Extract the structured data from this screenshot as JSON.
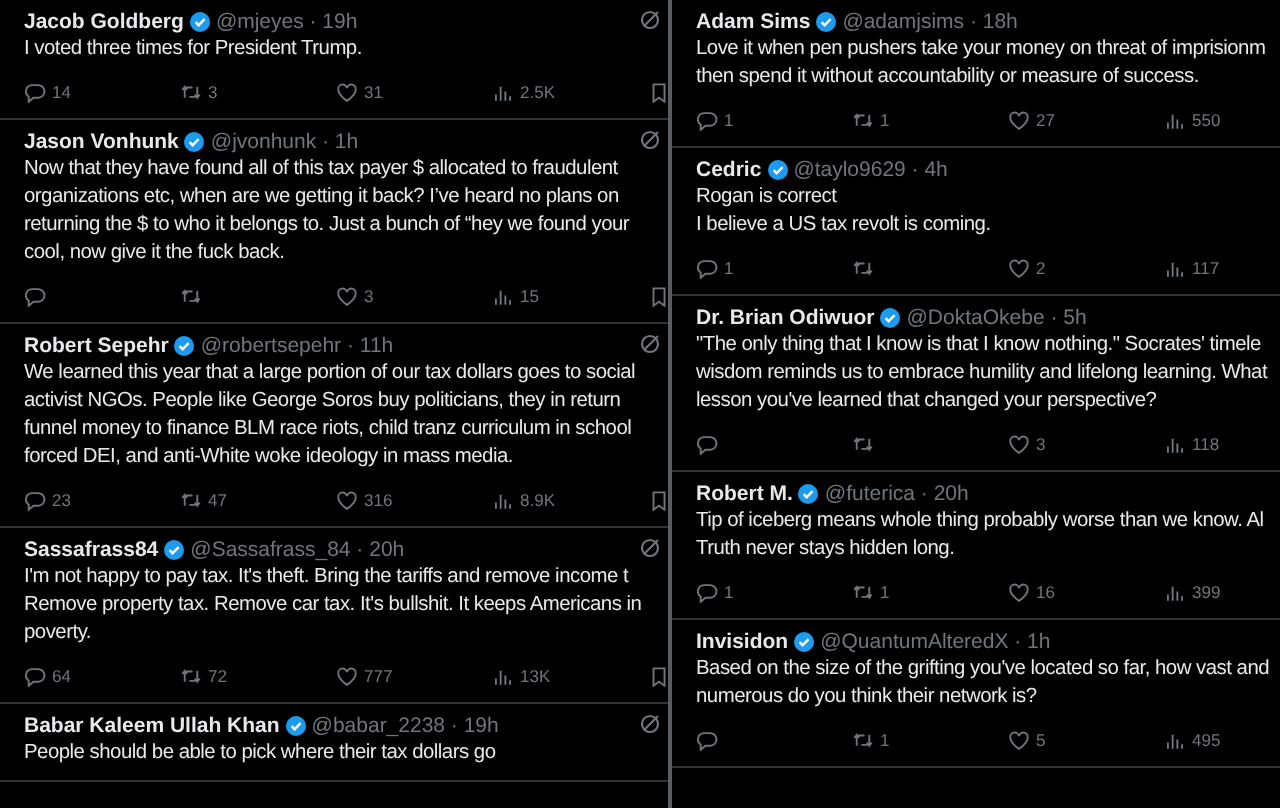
{
  "columns": [
    {
      "tweets": [
        {
          "name": "Jacob Goldberg",
          "meta": "@mjeyes · 19h",
          "menu_icon": true,
          "lines": [
            "I voted three times for President Trump."
          ],
          "actions": [
            {
              "kind": "reply",
              "count": "14"
            },
            {
              "kind": "repost",
              "count": "3"
            },
            {
              "kind": "like",
              "count": "31"
            },
            {
              "kind": "views",
              "count": "2.5K"
            },
            {
              "kind": "bookmark"
            }
          ]
        },
        {
          "name": "Jason Vonhunk",
          "meta": "@jvonhunk · 1h",
          "menu_icon": true,
          "lines": [
            "Now that they have found all of this tax payer $ allocated to fraudulent",
            "organizations etc, when are we getting it back? I’ve heard no plans on",
            "returning the $ to who it belongs to. Just a bunch of “hey we found your",
            "cool, now give it the fuck back."
          ],
          "actions": [
            {
              "kind": "reply"
            },
            {
              "kind": "repost"
            },
            {
              "kind": "like",
              "count": "3"
            },
            {
              "kind": "views",
              "count": "15"
            },
            {
              "kind": "bookmark"
            }
          ]
        },
        {
          "name": "Robert Sepehr",
          "meta": "@robertsepehr · 11h",
          "menu_icon": true,
          "lines": [
            "We learned this year that a large portion of our tax dollars goes to social",
            "activist NGOs. People like George Soros buy politicians, they in return",
            "funnel money to finance BLM race riots, child tranz curriculum in school",
            "forced DEI, and anti-White woke ideology in mass media."
          ],
          "actions": [
            {
              "kind": "reply",
              "count": "23"
            },
            {
              "kind": "repost",
              "count": "47"
            },
            {
              "kind": "like",
              "count": "316"
            },
            {
              "kind": "views",
              "count": "8.9K"
            },
            {
              "kind": "bookmark"
            }
          ]
        },
        {
          "name": "Sassafrass84",
          "meta": "@Sassafrass_84 · 20h",
          "menu_icon": true,
          "lines": [
            "I'm not happy to pay tax. It's theft. Bring the tariffs and remove income t",
            "Remove property tax. Remove car tax. It's bullshit. It keeps Americans in",
            "poverty."
          ],
          "actions": [
            {
              "kind": "reply",
              "count": "64"
            },
            {
              "kind": "repost",
              "count": "72"
            },
            {
              "kind": "like",
              "count": "777"
            },
            {
              "kind": "views",
              "count": "13K"
            },
            {
              "kind": "bookmark"
            }
          ]
        },
        {
          "name": "Babar Kaleem Ullah Khan",
          "meta": "@babar_2238 · 19h",
          "menu_icon": true,
          "lines": [
            "People should be able to pick where their tax dollars go"
          ]
        }
      ]
    },
    {
      "tweets": [
        {
          "name": "Adam Sims",
          "meta": "@adamjsims · 18h",
          "menu_icon": false,
          "lines": [
            "Love it when pen pushers take your money on threat of imprisionm",
            "then spend it without accountability or measure of success."
          ],
          "actions": [
            {
              "kind": "reply",
              "count": "1"
            },
            {
              "kind": "repost",
              "count": "1"
            },
            {
              "kind": "like",
              "count": "27"
            },
            {
              "kind": "views",
              "count": "550"
            }
          ]
        },
        {
          "name": "Cedric",
          "meta": "@taylo9629 · 4h",
          "menu_icon": false,
          "lines": [
            "Rogan is correct",
            "I believe a US tax revolt is coming."
          ],
          "actions": [
            {
              "kind": "reply",
              "count": "1"
            },
            {
              "kind": "repost"
            },
            {
              "kind": "like",
              "count": "2"
            },
            {
              "kind": "views",
              "count": "117"
            }
          ]
        },
        {
          "name": "Dr. Brian Odiwuor",
          "meta": "@DoktaOkebe · 5h",
          "menu_icon": false,
          "lines": [
            "\"The only thing that I know is that I know nothing.\" Socrates' timele",
            "wisdom reminds us to embrace humility and lifelong learning. What",
            "lesson you've learned that changed your perspective?"
          ],
          "actions": [
            {
              "kind": "reply"
            },
            {
              "kind": "repost"
            },
            {
              "kind": "like",
              "count": "3"
            },
            {
              "kind": "views",
              "count": "118"
            }
          ]
        },
        {
          "name": "Robert M.",
          "meta": "@futerica · 20h",
          "menu_icon": false,
          "lines": [
            "Tip of iceberg means whole thing probably worse than we know. Al",
            "Truth never stays hidden long."
          ],
          "actions": [
            {
              "kind": "reply",
              "count": "1"
            },
            {
              "kind": "repost",
              "count": "1"
            },
            {
              "kind": "like",
              "count": "16"
            },
            {
              "kind": "views",
              "count": "399"
            }
          ]
        },
        {
          "name": "Invisidon",
          "meta": "@QuantumAlteredX · 1h",
          "menu_icon": false,
          "lines": [
            "Based on the size of the grifting you've located so far, how vast and",
            "numerous do you think their network is?"
          ],
          "actions": [
            {
              "kind": "reply"
            },
            {
              "kind": "repost",
              "count": "1"
            },
            {
              "kind": "like",
              "count": "5"
            },
            {
              "kind": "views",
              "count": "495"
            }
          ]
        }
      ]
    }
  ]
}
